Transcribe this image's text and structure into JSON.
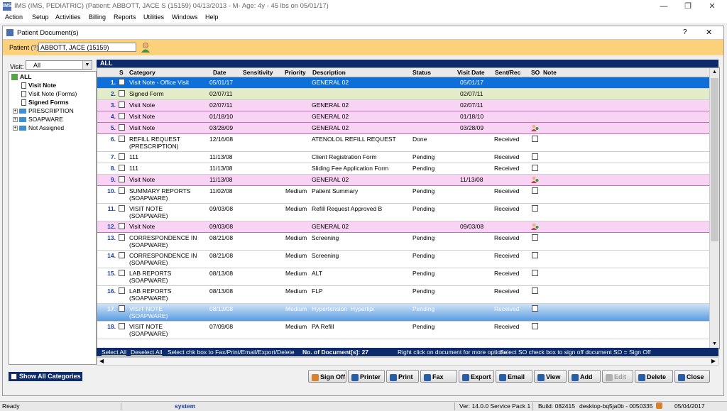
{
  "app": {
    "title": "IMS (IMS, PEDIATRIC)    (Patient: ABBOTT, JACE S (15159) 04/13/2013 - M- Age: 4y  - 45 lbs on 05/01/17)",
    "icon": "ims-app-icon"
  },
  "menu": [
    "Action",
    "Setup",
    "Activities",
    "Billing",
    "Reports",
    "Utilities",
    "Windows",
    "Help"
  ],
  "window_controls": {
    "minimize": "—",
    "restore": "❐",
    "close": "✕"
  },
  "doc_window": {
    "title": "Patient Document(s)",
    "help": "?",
    "close": "✕"
  },
  "patient": {
    "label": "Patient",
    "q": "(?)",
    "value": "ABBOTT, JACE  (15159)"
  },
  "visit": {
    "label": "Visit:",
    "value": "All"
  },
  "tree": [
    {
      "label": "ALL",
      "bold": true,
      "kind": "root"
    },
    {
      "label": "Visit Note",
      "bold": true,
      "kind": "doc"
    },
    {
      "label": "Visit Note (Forms)",
      "bold": false,
      "kind": "doc"
    },
    {
      "label": "Signed Forms",
      "bold": true,
      "kind": "doc"
    },
    {
      "label": "PRESCRIPTION",
      "bold": false,
      "kind": "folder"
    },
    {
      "label": "SOAPWARE",
      "bold": false,
      "kind": "folder"
    },
    {
      "label": "Not Assigned",
      "bold": false,
      "kind": "folder"
    }
  ],
  "grid": {
    "header": "ALL",
    "columns": [
      "S",
      "Category",
      "Date",
      "Sensitivity",
      "Priority",
      "Description",
      "Status",
      "Visit Date",
      "Sent/Rec",
      "SO",
      "Note"
    ],
    "rows": [
      {
        "n": "1.",
        "cat": "Visit Note - Office Visit",
        "date": "05/01/17",
        "pri": "",
        "desc": "GENERAL 02",
        "status": "",
        "vdate": "05/01/17",
        "sent": "",
        "so": "",
        "style": "selected"
      },
      {
        "n": "2.",
        "cat": "Signed Form",
        "date": "02/07/11",
        "pri": "",
        "desc": "",
        "status": "",
        "vdate": "02/07/11",
        "sent": "",
        "so": "",
        "style": "green"
      },
      {
        "n": "3.",
        "cat": "Visit Note",
        "date": "02/07/11",
        "pri": "",
        "desc": "GENERAL 02",
        "status": "",
        "vdate": "02/07/11",
        "sent": "",
        "so": "",
        "style": "pink"
      },
      {
        "n": "4.",
        "cat": "Visit Note",
        "date": "01/18/10",
        "pri": "",
        "desc": "GENERAL 02",
        "status": "",
        "vdate": "01/18/10",
        "sent": "",
        "so": "",
        "style": "pink"
      },
      {
        "n": "5.",
        "cat": "Visit Note",
        "date": "03/28/09",
        "pri": "",
        "desc": "GENERAL 02",
        "status": "",
        "vdate": "03/28/09",
        "sent": "",
        "so": "icon",
        "style": "pink"
      },
      {
        "n": "6.",
        "cat": "REFILL REQUEST\n(PRESCRIPTION)",
        "date": "12/16/08",
        "pri": "",
        "desc": "ATENOLOL REFILL REQUEST",
        "status": "Done",
        "vdate": "",
        "sent": "Received",
        "so": "box",
        "style": "white2"
      },
      {
        "n": "7.",
        "cat": "111",
        "date": "11/13/08",
        "pri": "",
        "desc": "Client Registration Form",
        "status": "Pending",
        "vdate": "",
        "sent": "Received",
        "so": "box",
        "style": "white"
      },
      {
        "n": "8.",
        "cat": "111",
        "date": "11/13/08",
        "pri": "",
        "desc": "Sliding Fee Application Form",
        "status": "Pending",
        "vdate": "",
        "sent": "Received",
        "so": "box",
        "style": "white"
      },
      {
        "n": "9.",
        "cat": "Visit Note",
        "date": "11/13/08",
        "pri": "",
        "desc": "GENERAL 02",
        "status": "",
        "vdate": "11/13/08",
        "sent": "",
        "so": "icon",
        "style": "pink"
      },
      {
        "n": "10.",
        "cat": "SUMMARY REPORTS\n(SOAPWARE)",
        "date": "11/02/08",
        "pri": "Medium",
        "desc": "Patient Summary",
        "status": "Pending",
        "vdate": "",
        "sent": "Received",
        "so": "box",
        "style": "white2"
      },
      {
        "n": "11.",
        "cat": "VISIT NOTE\n(SOAPWARE)",
        "date": "09/03/08",
        "pri": "Medium",
        "desc": "Refill Request Approved B",
        "status": "Pending",
        "vdate": "",
        "sent": "Received",
        "so": "box",
        "style": "white2"
      },
      {
        "n": "12.",
        "cat": "Visit Note",
        "date": "09/03/08",
        "pri": "",
        "desc": "GENERAL 02",
        "status": "",
        "vdate": "09/03/08",
        "sent": "",
        "so": "icon",
        "style": "pink"
      },
      {
        "n": "13.",
        "cat": "CORRESPONDENCE IN\n(SOAPWARE)",
        "date": "08/21/08",
        "pri": "Medium",
        "desc": "Screening",
        "status": "Pending",
        "vdate": "",
        "sent": "Received",
        "so": "box",
        "style": "white2"
      },
      {
        "n": "14.",
        "cat": "CORRESPONDENCE IN\n(SOAPWARE)",
        "date": "08/21/08",
        "pri": "Medium",
        "desc": "Screening",
        "status": "Pending",
        "vdate": "",
        "sent": "Received",
        "so": "box",
        "style": "white2"
      },
      {
        "n": "15.",
        "cat": "LAB REPORTS\n(SOAPWARE)",
        "date": "08/13/08",
        "pri": "Medium",
        "desc": "ALT",
        "status": "Pending",
        "vdate": "",
        "sent": "Received",
        "so": "box",
        "style": "white2"
      },
      {
        "n": "16.",
        "cat": "LAB REPORTS\n(SOAPWARE)",
        "date": "08/13/08",
        "pri": "Medium",
        "desc": "FLP",
        "status": "Pending",
        "vdate": "",
        "sent": "Received",
        "so": "box",
        "style": "white2"
      },
      {
        "n": "17.",
        "cat": "VISIT NOTE\n(SOAPWARE)",
        "date": "08/13/08",
        "pri": "Medium",
        "desc": "Hypertension  Hyperlipi",
        "status": "Pending",
        "vdate": "",
        "sent": "Received",
        "so": "box",
        "style": "hover"
      },
      {
        "n": "18.",
        "cat": "VISIT NOTE\n(SOAPWARE)",
        "date": "07/09/08",
        "pri": "Medium",
        "desc": "PA Refill",
        "status": "Pending",
        "vdate": "",
        "sent": "Received",
        "so": "box",
        "style": "white2"
      }
    ]
  },
  "footer": {
    "select_all": "Select All",
    "deselect_all": "Deselect All",
    "hint": "Select chk box to Fax/Print/Email/Export/Delete",
    "count": "No. of Document[s]:  27",
    "right_click": "Right click on document for more options",
    "so_hint": "Select SO check box to sign off document    SO = Sign Off"
  },
  "show_all": "Show All Categories",
  "buttons": [
    {
      "label": "Sign Off",
      "icon": "signoff-icon",
      "color": "#d9822b",
      "disabled": false
    },
    {
      "label": "Printer",
      "icon": "printer-icon",
      "color": "#2a5da8",
      "disabled": false
    },
    {
      "label": "Print",
      "icon": "print-icon",
      "color": "#2a5da8",
      "disabled": false
    },
    {
      "label": "Fax",
      "icon": "fax-icon",
      "color": "#2a5da8",
      "disabled": false
    },
    {
      "label": "Export",
      "icon": "export-icon",
      "color": "#2a5da8",
      "disabled": false
    },
    {
      "label": "Email",
      "icon": "email-icon",
      "color": "#2a5da8",
      "disabled": false
    },
    {
      "label": "View",
      "icon": "view-icon",
      "color": "#2a5da8",
      "disabled": false
    },
    {
      "label": "Add",
      "icon": "add-icon",
      "color": "#2a5da8",
      "disabled": false
    },
    {
      "label": "Edit",
      "icon": "edit-icon",
      "color": "#b0b0b0",
      "disabled": true
    },
    {
      "label": "Delete",
      "icon": "delete-icon",
      "color": "#2a5da8",
      "disabled": false
    },
    {
      "label": "Close",
      "icon": "close-icon",
      "color": "#2a5da8",
      "disabled": false
    }
  ],
  "status": {
    "ready": "Ready",
    "user": "system",
    "version": "Ver: 14.0.0 Service Pack 1",
    "build": "Build: 082415",
    "machine": "desktop-bq5ja0b - 0050335",
    "date": "05/04/2017"
  },
  "colors": {
    "navy": "#0d2a6b",
    "selected": "#0f6fd8",
    "pink": "#f9d3f4",
    "green": "#e2ecc8",
    "patient_bar": "#fbd27b"
  }
}
